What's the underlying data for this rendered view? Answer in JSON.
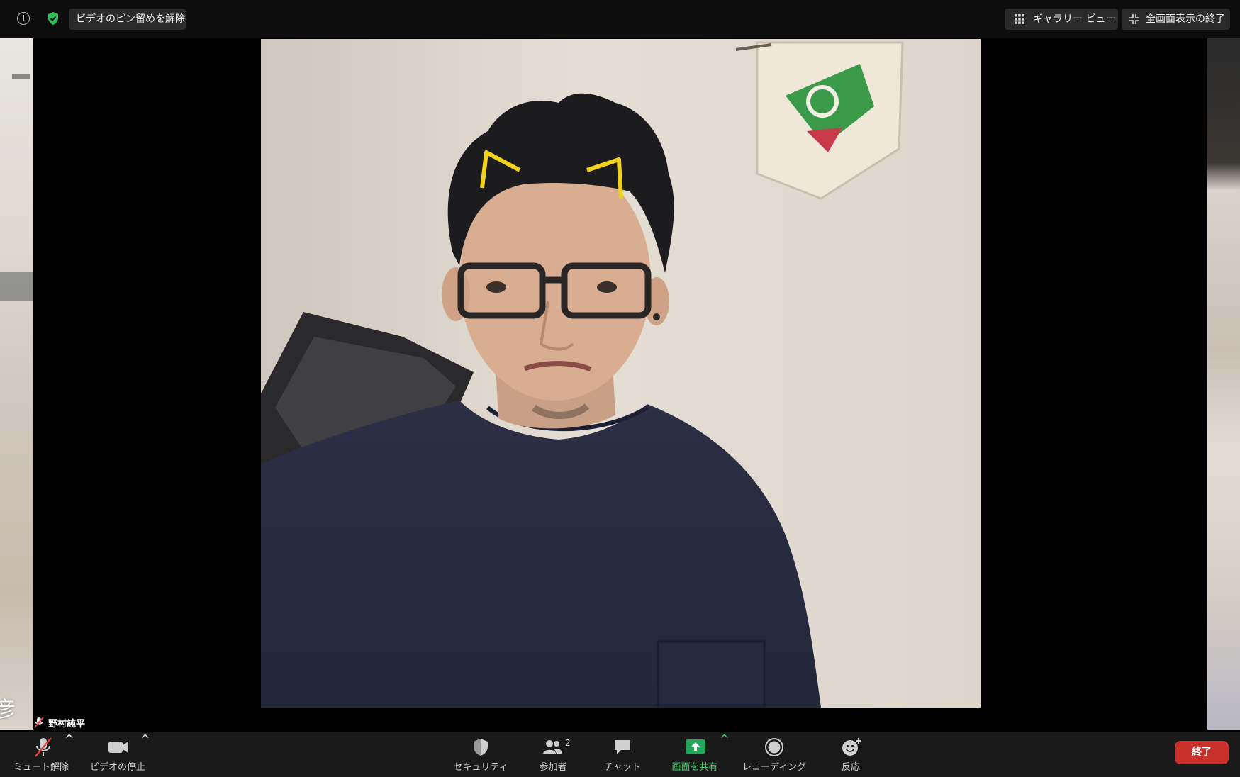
{
  "topbar": {
    "unpin_label": "ビデオのピン留めを解除",
    "gallery_label": "ギャラリー ビュー",
    "exit_fullscreen_label": "全画面表示の終了"
  },
  "video": {
    "pinned_participant_name": "野村純平",
    "left_tile_name_fragment": "彦"
  },
  "toolbar": {
    "unmute_label": "ミュート解除",
    "stop_video_label": "ビデオの停止",
    "security_label": "セキュリティ",
    "participants_label": "参加者",
    "participants_count": "2",
    "chat_label": "チャット",
    "share_screen_label": "画面を共有",
    "recording_label": "レコーディング",
    "reactions_label": "反応",
    "end_label": "終了"
  },
  "colors": {
    "toolbar_bg": "#1a1a1a",
    "share_green": "#23a55a",
    "end_red": "#c9302c",
    "secure_green": "#2fbf5a"
  }
}
